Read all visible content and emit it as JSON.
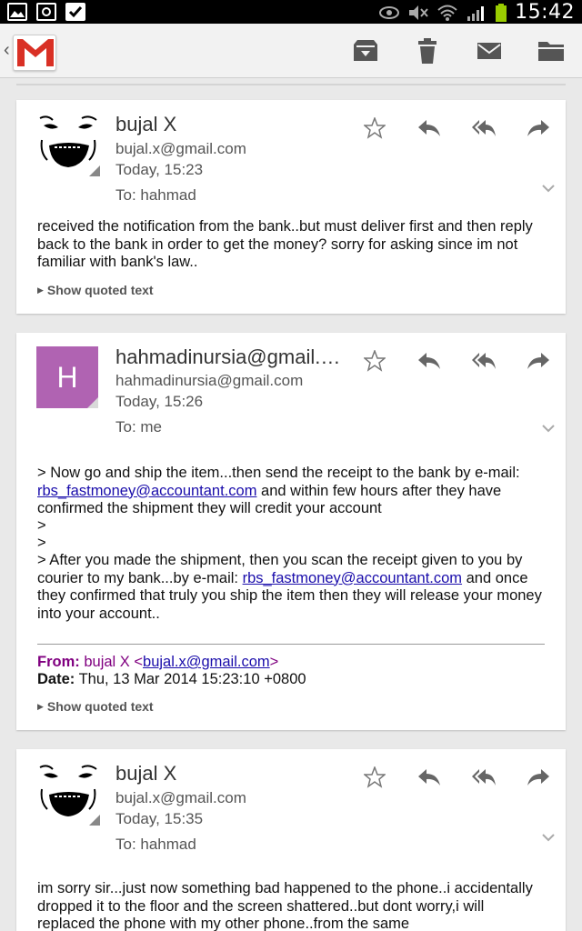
{
  "status_bar": {
    "time": "15:42",
    "icons": [
      "gallery-notification-icon",
      "camera-notification-icon",
      "checkbox-notification-icon",
      "eye-icon",
      "mute-icon",
      "wifi-icon",
      "signal-icon",
      "battery-icon"
    ]
  },
  "action_bar": {
    "app_icon": "gmail-logo",
    "actions": [
      "archive-icon",
      "delete-icon",
      "mark-unread-icon",
      "move-to-folder-icon"
    ]
  },
  "messages": [
    {
      "sender": "bujal X",
      "email": "bujal.x@gmail.com",
      "date": "Today, 15:23",
      "to": "To: hahmad",
      "body": "received the notification from the bank..but must deliver first and then reply back to the bank in order to get the money? sorry for asking since im not familiar with bank's law..",
      "show_quoted": "Show quoted text"
    },
    {
      "sender": "hahmadinursia@gmail.c...",
      "avatar_letter": "H",
      "avatar_color": "#b063b2",
      "email": "hahmadinursia@gmail.com",
      "date": "Today, 15:26",
      "to": "To: me",
      "quote1_a": "> Now go and ship the item...then send the receipt to the bank by e-mail: ",
      "link1": "rbs_fastmoney@accountant.com",
      "quote1_b": " and within few hours after they have confirmed the shipment they will credit your account",
      "gt1": ">",
      "gt2": ">",
      "quote2_a": "> After you made the shipment, then you scan the receipt given to you by courier to my bank...by e-mail: ",
      "link2": "rbs_fastmoney@accountant.com",
      "quote2_b": " and once they confirmed that truly you ship the item then they will release your money into your account..",
      "from_label": "From:",
      "from_name": "bujal X <",
      "from_email": "bujal.x@gmail.com",
      "from_close": ">",
      "date_label": "Date:",
      "date_value": "Thu, 13 Mar 2014 15:23:10 +0800",
      "show_quoted": "Show quoted text"
    },
    {
      "sender": "bujal X",
      "email": "bujal.x@gmail.com",
      "date": "Today, 15:35",
      "to": "To: hahmad",
      "body": "im sorry sir...just now something bad happened to the phone..i accidentally dropped it to the floor and the screen shattered..but dont worry,i will replaced the phone with my other phone..from the same"
    }
  ],
  "colors": {
    "link": "#1a0dab",
    "quote_header": "#800080",
    "gmail_red": "#d93025"
  }
}
